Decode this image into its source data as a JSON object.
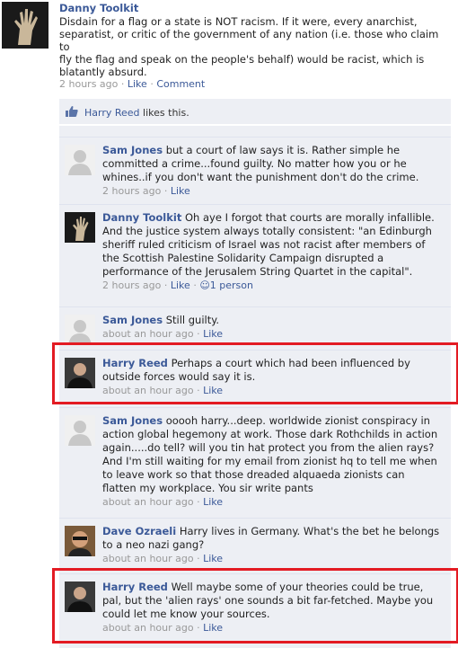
{
  "post": {
    "author": "Danny Toolkit",
    "lines": [
      "Disdain for a flag or a state is NOT racism. If it were, every anarchist,",
      "separatist, or critic of the government of any nation (i.e. those who claim to",
      "fly the flag and speak on the people's behalf) would be racist, which is",
      "blatantly absurd."
    ],
    "time": "2 hours ago",
    "sep": "·",
    "like": "Like",
    "comment": "Comment"
  },
  "likes": {
    "who": "Harry Reed",
    "text": " likes this."
  },
  "comments": [
    {
      "author": "Sam Jones",
      "lines": [
        " but a court of law says it is. Rather simple he",
        "committed a crime...found guilty. No matter how you or he",
        "whines..if you don't want the punishment don't do the crime."
      ],
      "time": "2 hours ago",
      "like": "Like"
    },
    {
      "author": "Danny Toolkit",
      "lines": [
        " Oh aye I forgot that courts are morally infallible.",
        "And the justice system always totally consistent: \"an Edinburgh",
        "sheriff ruled criticism of Israel was not racist after members of",
        "the Scottish Palestine Solidarity Campaign disrupted a",
        "performance of the Jerusalem String Quartet in the capital\"."
      ],
      "time": "2 hours ago",
      "like": "Like",
      "likes_count": "1 person"
    },
    {
      "author": "Sam Jones",
      "lines": [
        " Still guilty."
      ],
      "time": "about an hour ago",
      "like": "Like"
    },
    {
      "author": "Harry Reed",
      "lines": [
        " Perhaps a court which had been influenced by",
        "outside forces would say it is."
      ],
      "time": "about an hour ago",
      "like": "Like"
    },
    {
      "author": "Sam Jones",
      "lines": [
        " ooooh harry...deep. worldwide zionist conspiracy in",
        "action global hegemony at work. Those dark Rothchilds in action",
        "again.....do tell? will you tin hat protect you from the alien rays?",
        "And I'm still waiting for my email from zionist hq to tell me when",
        "to leave work so that those dreaded alquaeda zionists can",
        "flatten my workplace. You sir write pants"
      ],
      "time": "about an hour ago",
      "like": "Like"
    },
    {
      "author": "Dave Ozraeli",
      "lines": [
        " Harry lives in Germany. What's the bet he belongs",
        "to a neo nazi gang?"
      ],
      "time": "about an hour ago",
      "like": "Like"
    },
    {
      "author": "Harry Reed",
      "lines": [
        " Well maybe some of your theories could be true,",
        "pal, but the 'alien rays' one sounds a bit far-fetched. Maybe you",
        "could let me know your sources."
      ],
      "time": "about an hour ago",
      "like": "Like"
    }
  ]
}
